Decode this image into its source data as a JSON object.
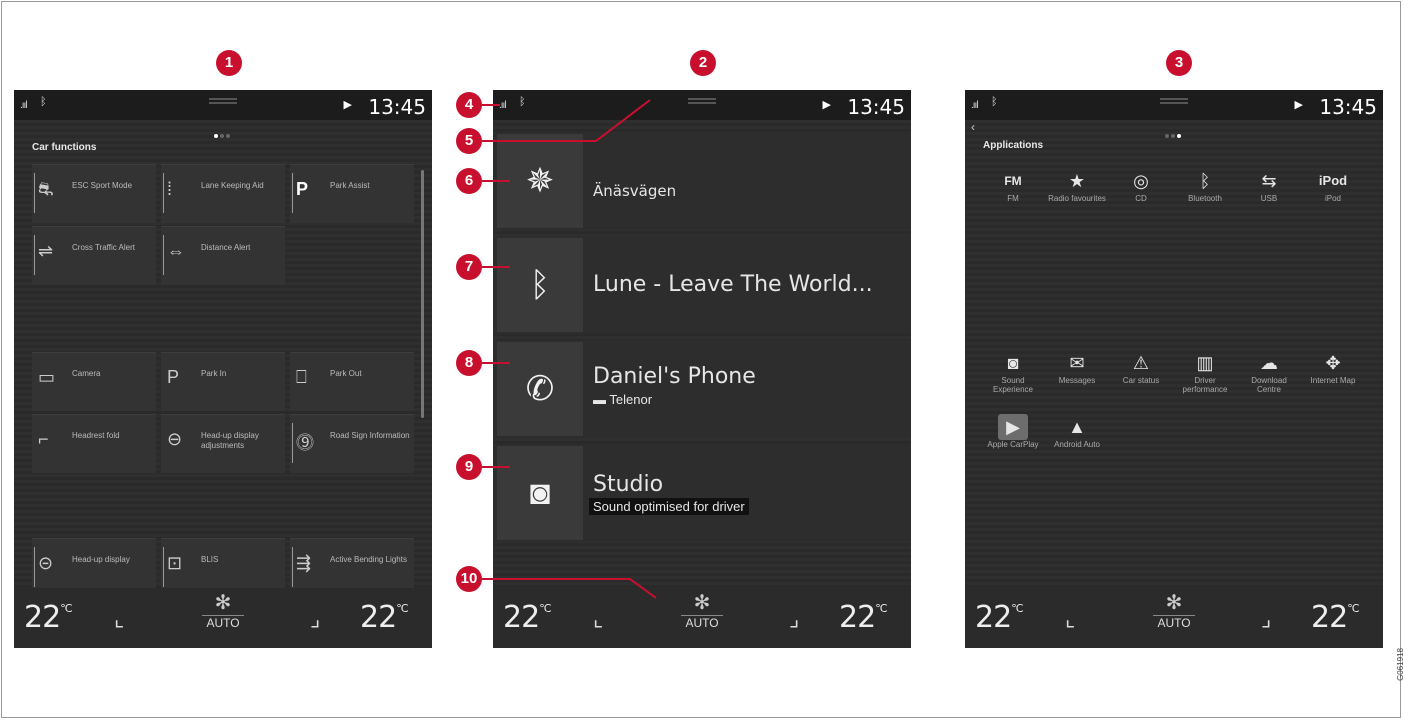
{
  "callouts": [
    "1",
    "2",
    "3",
    "4",
    "5",
    "6",
    "7",
    "8",
    "9",
    "10"
  ],
  "status": {
    "time": "13:45"
  },
  "climate": {
    "temp_left": "22",
    "temp_right": "22",
    "unit": "°C",
    "mode": "AUTO"
  },
  "screen1": {
    "title": "Car functions",
    "tiles": [
      "ESC Sport Mode",
      "Lane Keeping Aid",
      "Park Assist",
      "Cross Traffic Alert",
      "Distance Alert",
      "Camera",
      "Park In",
      "Park Out",
      "Headrest fold",
      "Head-up display adjustments",
      "Road Sign Information",
      "Head-up display",
      "BLIS",
      "Active Bending Lights"
    ]
  },
  "screen2": {
    "nav": {
      "title": "Änäsvägen"
    },
    "media": {
      "title": "Lune - Leave The World..."
    },
    "phone": {
      "title": "Daniel's Phone",
      "sub": "Telenor"
    },
    "audio": {
      "title": "Studio",
      "sub": "Sound optimised for driver"
    }
  },
  "screen3": {
    "title": "Applications",
    "apps_top": [
      {
        "icon": "FM",
        "label": "FM"
      },
      {
        "icon": "★",
        "label": "Radio favourites"
      },
      {
        "icon": "◎",
        "label": "CD"
      },
      {
        "icon": "ᛒ",
        "label": "Bluetooth"
      },
      {
        "icon": "⇆",
        "label": "USB"
      },
      {
        "icon": "iPod",
        "label": "iPod"
      }
    ],
    "apps_bottom": [
      {
        "icon": "◙",
        "label": "Sound Experience"
      },
      {
        "icon": "✉",
        "label": "Messages"
      },
      {
        "icon": "⚠",
        "label": "Car status"
      },
      {
        "icon": "▥",
        "label": "Driver performance"
      },
      {
        "icon": "☁",
        "label": "Download Centre"
      },
      {
        "icon": "✥",
        "label": "Internet Map"
      },
      {
        "icon": "▶",
        "label": "Apple CarPlay"
      },
      {
        "icon": "▲",
        "label": "Android Auto"
      }
    ]
  },
  "doc_id": "G061918"
}
